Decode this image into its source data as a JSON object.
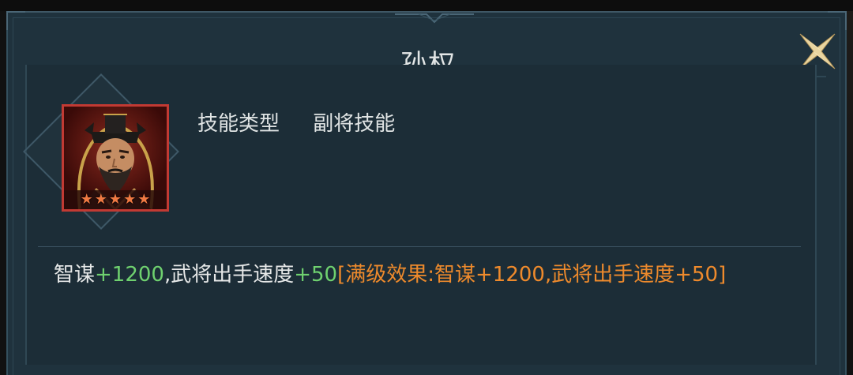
{
  "title": "孙权",
  "skill_type": {
    "label": "技能类型",
    "value": "副将技能"
  },
  "general": {
    "stars": 5,
    "star_glyph": "★",
    "frame_color": "#c23a33"
  },
  "description": {
    "part1": "智谋",
    "part2": "+1200",
    "part3": ",武将出手速度",
    "part4": "+50",
    "part5": "[满级效果:智谋+1200,武将出手速度+50]"
  },
  "colors": {
    "bonus": "#6fd16f",
    "max_effect": "#ee8a2c"
  },
  "icons": {
    "close": "close-x-icon"
  }
}
